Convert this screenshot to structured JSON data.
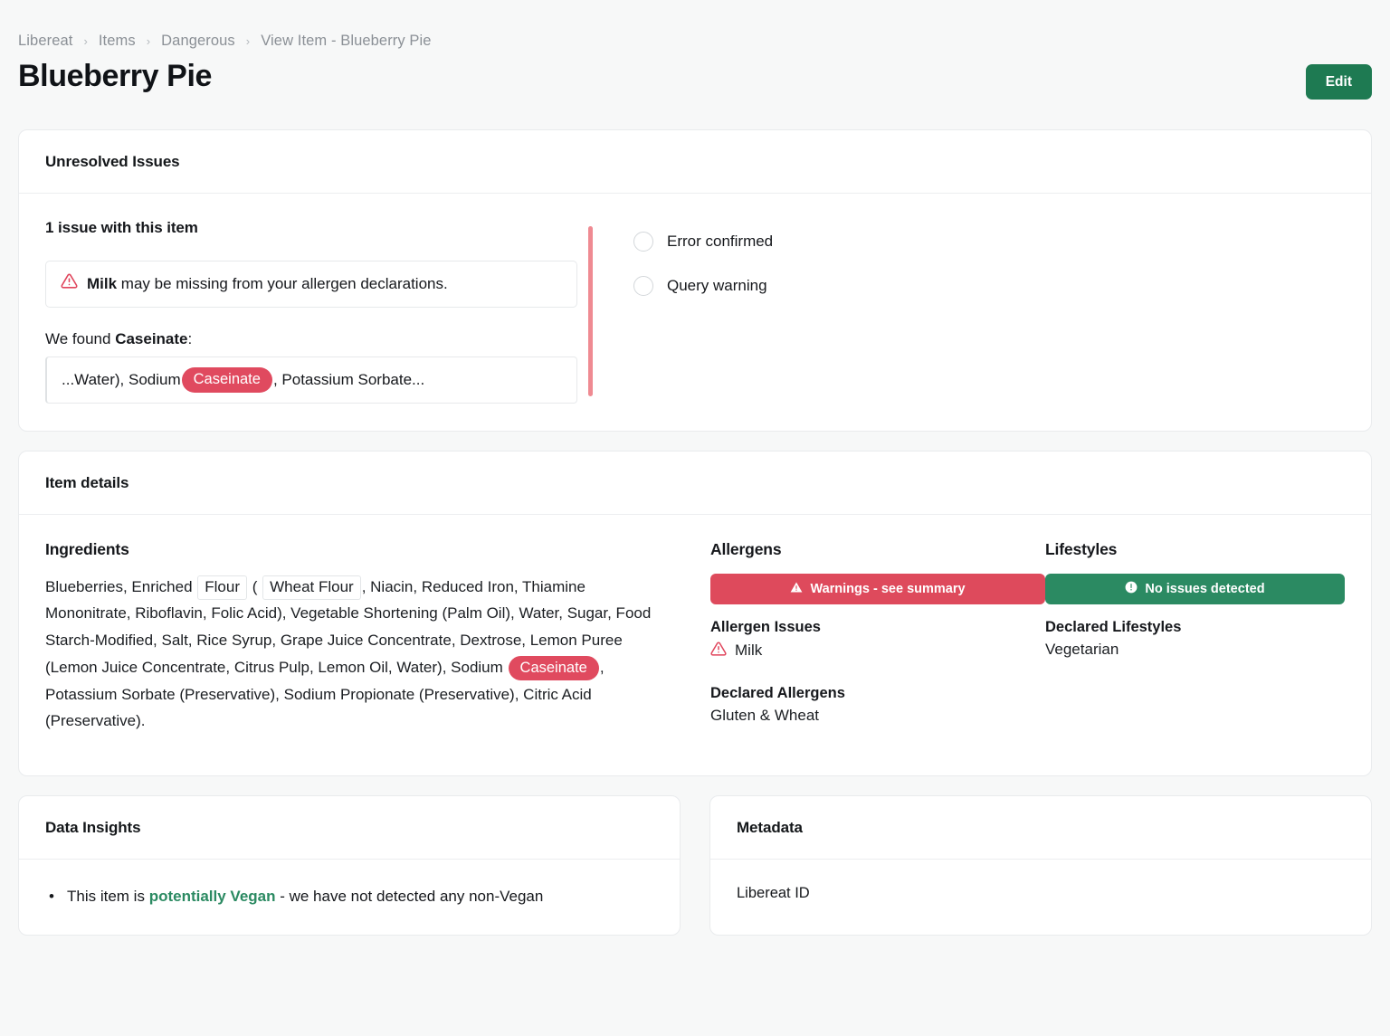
{
  "breadcrumb": {
    "items": [
      {
        "label": "Libereat"
      },
      {
        "label": "Items"
      },
      {
        "label": "Dangerous"
      },
      {
        "label": "View Item - Blueberry Pie"
      }
    ],
    "separator": "›"
  },
  "header": {
    "title": "Blueberry Pie",
    "edit_label": "Edit",
    "accent_green": "#1e7a52"
  },
  "issues_card": {
    "title": "Unresolved Issues",
    "count_text": "1 issue with this item",
    "alert": {
      "icon": "warning-triangle-icon",
      "bold": "Milk",
      "rest": " may be missing from your allergen declarations."
    },
    "found_prefix": "We found ",
    "found_term": "Caseinate",
    "found_suffix": ":",
    "snippet": {
      "before": "...Water), Sodium ",
      "highlight": "Caseinate",
      "after": ", Potassium Sorbate..."
    },
    "options": [
      {
        "label": "Error confirmed"
      },
      {
        "label": "Query warning"
      }
    ],
    "divider_color": "#ef8a92",
    "pill_color": "#e04a5f"
  },
  "item_details": {
    "title": "Item details",
    "ingredients": {
      "heading": "Ingredients",
      "part1": "Blueberries, Enriched ",
      "token1": "Flour",
      "part2": " ( ",
      "token2": "Wheat Flour",
      "part3": ", Niacin, Reduced Iron, Thiamine Mononitrate, Riboflavin, Folic Acid), Vegetable Shortening (Palm Oil), Water, Sugar, Food Starch-Modified, Salt, Rice Syrup, Grape Juice Concentrate, Dextrose, Lemon Puree (Lemon Juice Concentrate, Citrus Pulp, Lemon Oil, Water), Sodium ",
      "token3": "Caseinate",
      "part4": ", Potassium Sorbate (Preservative), Sodium Propionate (Preservative), Citric Acid (Preservative)."
    },
    "allergens": {
      "heading": "Allergens",
      "badge_text": "Warnings - see summary",
      "badge_icon": "warning-triangle-filled-icon",
      "badge_color": "#de4a5c",
      "issues_label": "Allergen Issues",
      "issues_value": "Milk",
      "declared_label": "Declared Allergens",
      "declared_value": "Gluten & Wheat"
    },
    "lifestyles": {
      "heading": "Lifestyles",
      "badge_text": "No issues detected",
      "badge_icon": "info-circle-icon",
      "badge_color": "#2b8a62",
      "declared_label": "Declared Lifestyles",
      "declared_value": "Vegetarian"
    }
  },
  "data_insights": {
    "title": "Data Insights",
    "items": [
      {
        "before": "This item is ",
        "emphasis": "potentially Vegan",
        "after": " - we have not detected any non-Vegan"
      }
    ]
  },
  "metadata": {
    "title": "Metadata",
    "fields": [
      {
        "label": "Libereat ID"
      }
    ]
  }
}
